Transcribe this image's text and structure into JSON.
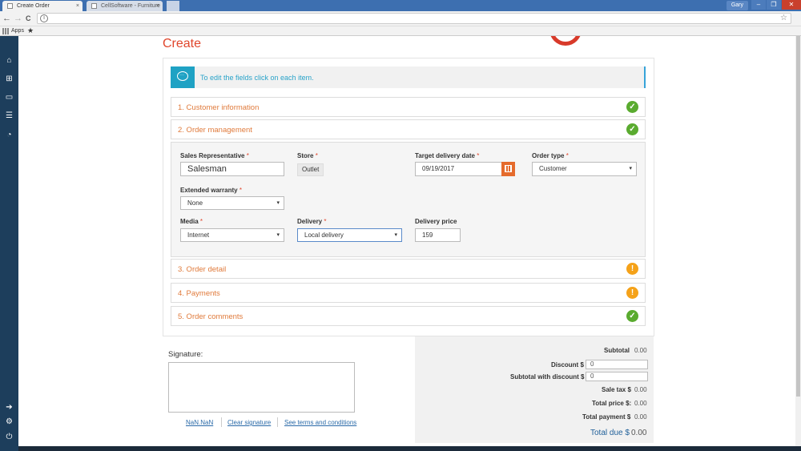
{
  "browser": {
    "tabs": [
      {
        "title": "Create Order"
      },
      {
        "title": "CellSoftware - Furniture"
      }
    ],
    "tab_close_glyph": "×",
    "user": "Gary",
    "window_controls": [
      "–",
      "❐",
      "✕"
    ],
    "nav": {
      "back": "←",
      "forward": "→",
      "reload": "C"
    },
    "omnibox_info": "i",
    "omnibox_star": "☆",
    "bookmarks": {
      "apps_label": "Apps",
      "star": "★"
    }
  },
  "sidebar": {
    "icons": [
      {
        "name": "home-icon",
        "glyph": "⌂"
      },
      {
        "name": "plus-box-icon",
        "glyph": "⊞"
      },
      {
        "name": "laptop-icon",
        "glyph": "▭"
      },
      {
        "name": "list-icon",
        "glyph": "☰"
      },
      {
        "name": "dashboard-icon",
        "glyph": "◔"
      },
      {
        "name": "logout-arrow-icon",
        "glyph": "➔"
      },
      {
        "name": "gear-icon",
        "glyph": "⚙"
      },
      {
        "name": "power-icon",
        "glyph": "⏻"
      }
    ]
  },
  "page": {
    "title": "Create",
    "info_message": "To edit the fields click on each item.",
    "info_icon_dots": "···"
  },
  "sections": [
    {
      "label": "1. Customer information",
      "status": "ok"
    },
    {
      "label": "2. Order management",
      "status": "ok"
    },
    {
      "label": "3. Order detail",
      "status": "warn"
    },
    {
      "label": "4. Payments",
      "status": "warn"
    },
    {
      "label": "5. Order comments",
      "status": "ok"
    }
  ],
  "status_glyphs": {
    "ok": "✓",
    "warn": "!"
  },
  "order": {
    "sales_rep": {
      "label": "Sales Representative",
      "value": "Salesman"
    },
    "store": {
      "label": "Store",
      "value": "Outlet"
    },
    "target_date": {
      "label": "Target delivery date",
      "value": "09/19/2017"
    },
    "order_type": {
      "label": "Order type",
      "value": "Customer"
    },
    "warranty": {
      "label": "Extended warranty",
      "value": "None"
    },
    "media": {
      "label": "Media",
      "value": "Internet"
    },
    "delivery": {
      "label": "Delivery",
      "value": "Local delivery"
    },
    "delivery_price": {
      "label": "Delivery price",
      "value": "159"
    },
    "required_mark": "*"
  },
  "signature": {
    "label": "Signature:",
    "links": [
      "NaN.NaN",
      "Clear signature",
      "See terms and conditions"
    ]
  },
  "totals": {
    "subtotal": {
      "label": "Subtotal",
      "value": "0.00"
    },
    "discount": {
      "label": "Discount $",
      "value": "0"
    },
    "subtotal_discount": {
      "label": "Subtotal with discount $",
      "value": "0"
    },
    "sale_tax": {
      "label": "Sale tax $",
      "value": "0.00"
    },
    "total_price": {
      "label": "Total price $:",
      "value": "0.00"
    },
    "total_payment": {
      "label": "Total payment $",
      "value": "0.00"
    },
    "total_due": {
      "label": "Total due $",
      "value": "0.00"
    }
  },
  "colors": {
    "accent": "#e0452b",
    "section_text": "#e07a3b",
    "ok": "#5aab2f",
    "warn": "#f5a219",
    "sidebar": "#1d3e5c",
    "info": "#1fa2c4"
  }
}
